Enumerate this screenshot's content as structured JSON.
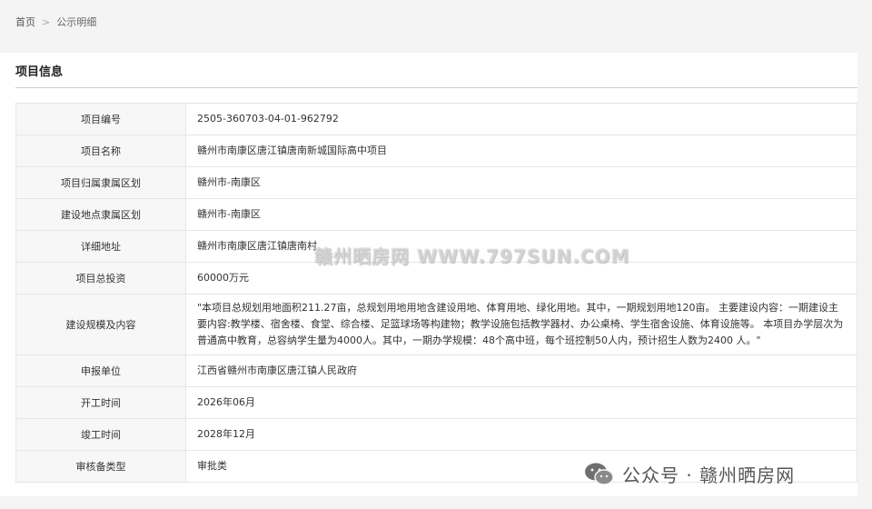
{
  "breadcrumb": {
    "home": "首页",
    "separator": ">",
    "current": "公示明细"
  },
  "section": {
    "title": "项目信息"
  },
  "rows": [
    {
      "label": "项目编号",
      "value": "2505-360703-04-01-962792"
    },
    {
      "label": "项目名称",
      "value": "赣州市南康区唐江镇唐南新城国际高中项目"
    },
    {
      "label": "项目归属隶属区划",
      "value": "赣州市-南康区"
    },
    {
      "label": "建设地点隶属区划",
      "value": "赣州市-南康区"
    },
    {
      "label": "详细地址",
      "value": "赣州市南康区唐江镇唐南村"
    },
    {
      "label": "项目总投资",
      "value": "60000万元"
    },
    {
      "label": "建设规模及内容",
      "value": "\"本项目总规划用地面积211.27亩，总规划用地用地含建设用地、体育用地、绿化用地。其中，一期规划用地120亩。 主要建设内容：一期建设主要内容:教学楼、宿舍楼、食堂、综合楼、足篮球场等构建物；教学设施包括教学器材、办公桌椅、学生宿舍设施、体育设施等。 本项目办学层次为普通高中教育，总容纳学生量为4000人。其中，一期办学规模：48个高中班，每个班控制50人内，预计招生人数为2400 人。\""
    },
    {
      "label": "申报单位",
      "value": "江西省赣州市南康区唐江镇人民政府"
    },
    {
      "label": "开工时间",
      "value": "2026年06月"
    },
    {
      "label": "竣工时间",
      "value": "2028年12月"
    },
    {
      "label": "审核备类型",
      "value": "审批类"
    }
  ],
  "watermarks": {
    "center": "赣州晒房网 WWW.797SUN.COM",
    "bottom": "公众号 · 赣州晒房网",
    "bottom_icon": "wechat-icon"
  }
}
